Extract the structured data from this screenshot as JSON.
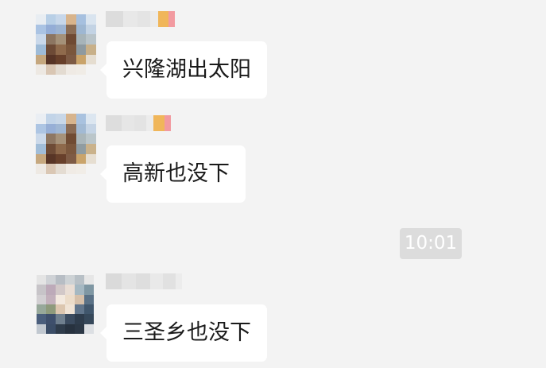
{
  "chat": {
    "timestamp": "10:01",
    "messages": [
      {
        "text": "兴隆湖出太阳",
        "avatar_icon": "blurred-avatar-icon"
      },
      {
        "text": "高新也没下",
        "avatar_icon": "blurred-avatar-icon"
      },
      {
        "text": "三圣乡也没下",
        "avatar_icon": "blurred-avatar-icon"
      }
    ]
  },
  "colors": {
    "background": "#f3f3f3",
    "bubble": "#ffffff",
    "text": "#1a1a1a",
    "timestamp_bg": "#dcdcdc",
    "timestamp_text": "#ffffff"
  }
}
